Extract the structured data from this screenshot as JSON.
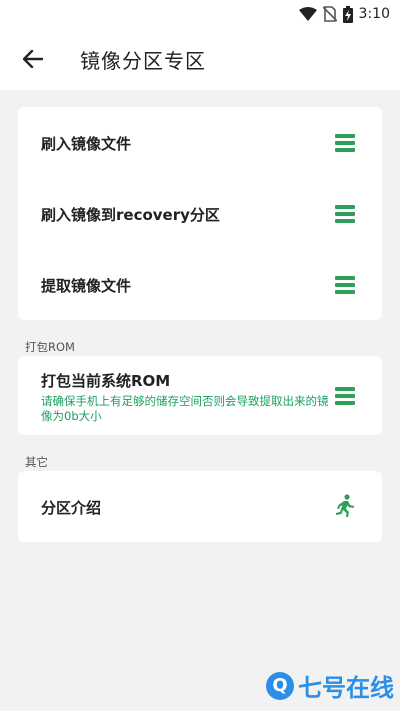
{
  "status_bar": {
    "time": "3:10",
    "icons": [
      "wifi-icon",
      "no-sim-icon",
      "battery-charging-icon"
    ]
  },
  "app_bar": {
    "back_icon": "arrow-back-icon",
    "title": "镜像分区专区"
  },
  "colors": {
    "accent": "#2e9e5b",
    "subtext": "#1aa060",
    "background": "#f2f2f2",
    "card": "#ffffff"
  },
  "card_flash": {
    "items": [
      {
        "label": "刷入镜像文件",
        "icon": "menu-icon"
      },
      {
        "label": "刷入镜像到recovery分区",
        "icon": "menu-icon"
      },
      {
        "label": "提取镜像文件",
        "icon": "menu-icon"
      }
    ]
  },
  "section_pack": {
    "header": "打包ROM",
    "item": {
      "label": "打包当前系统ROM",
      "description": "请确保手机上有足够的储存空间否则会导致提取出来的镜像为0b大小",
      "icon": "menu-icon"
    }
  },
  "section_other": {
    "header": "其它",
    "item": {
      "label": "分区介绍",
      "icon": "running-person-icon"
    }
  },
  "watermark": {
    "text": "七号在线",
    "glyph": "Q"
  }
}
